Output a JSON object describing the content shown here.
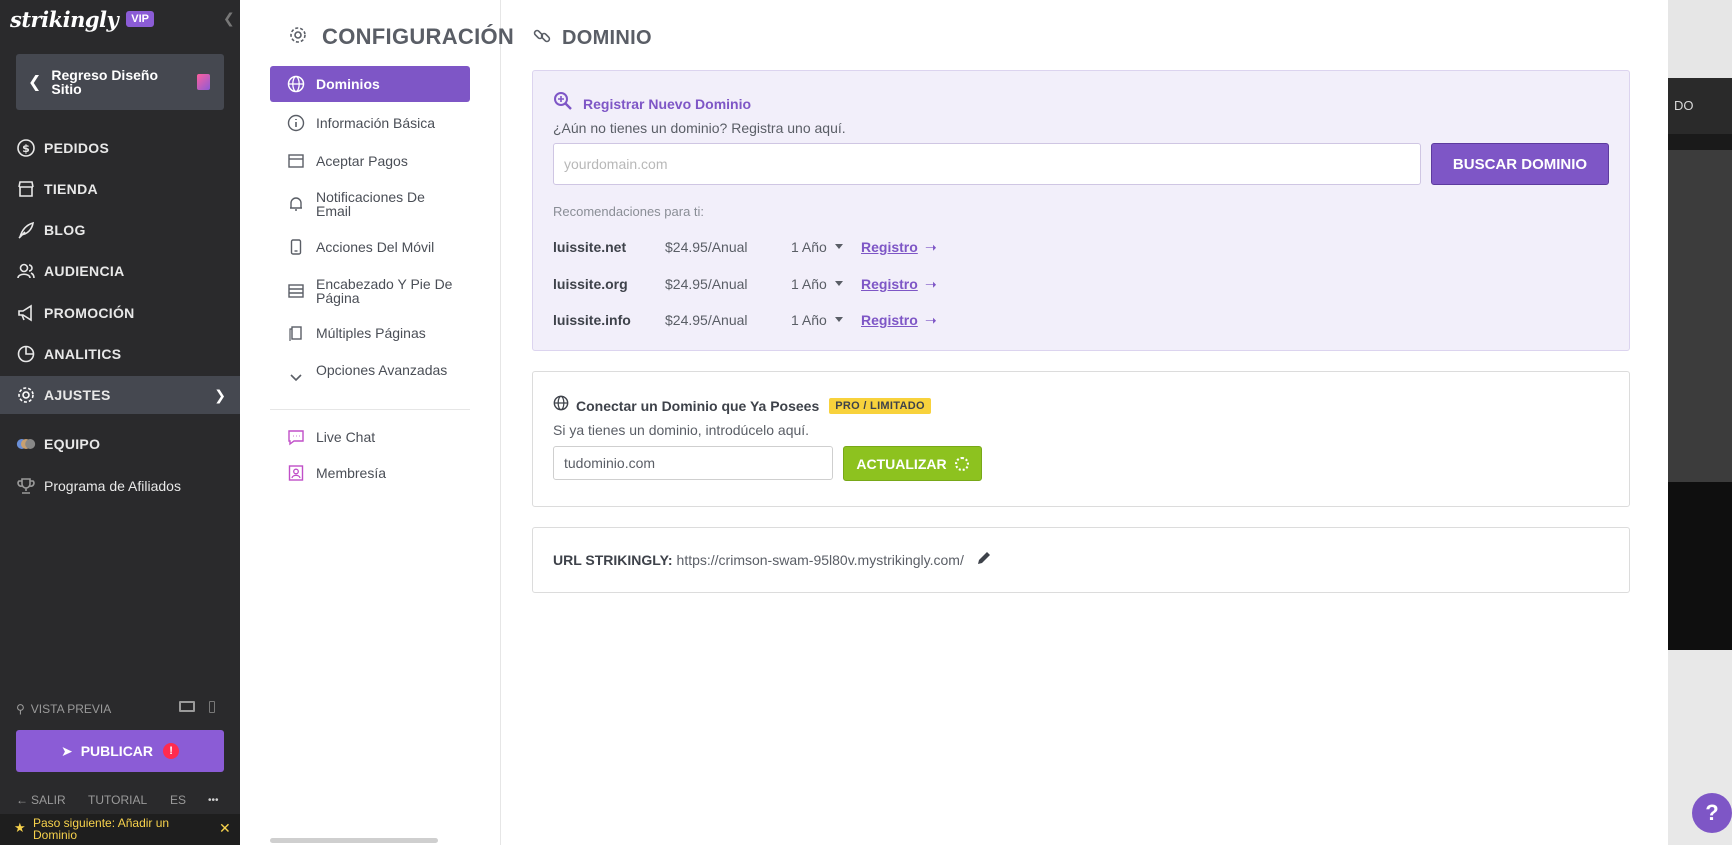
{
  "sidebar": {
    "logo": "strikingly",
    "vip_badge": "VIP",
    "back_button": "Regreso Diseño Sitio",
    "nav": [
      {
        "label": "PEDIDOS",
        "icon": "dollar-circle-icon"
      },
      {
        "label": "TIENDA",
        "icon": "store-icon"
      },
      {
        "label": "BLOG",
        "icon": "feather-icon"
      },
      {
        "label": "AUDIENCIA",
        "icon": "people-icon"
      },
      {
        "label": "PROMOCIÓN",
        "icon": "megaphone-icon"
      },
      {
        "label": "ANALITICS",
        "icon": "pie-chart-icon"
      },
      {
        "label": "AJUSTES",
        "icon": "gear-icon",
        "active": true
      },
      {
        "label": "EQUIPO",
        "icon": "team-avatars-icon"
      },
      {
        "label": "Programa de Afiliados",
        "icon": "trophy-icon"
      }
    ],
    "preview_label": "VISTA PREVIA",
    "publish_label": "PUBLICAR",
    "publish_alert": "!",
    "footer": {
      "exit": "SALIR",
      "tutorial": "TUTORIAL",
      "lang": "ES",
      "more": "•••"
    },
    "next_step": "Paso siguiente: Añadir un Dominio"
  },
  "settings": {
    "title": "CONFIGURACIÓN",
    "items": [
      {
        "label": "Dominios",
        "icon": "globe-icon",
        "active": true
      },
      {
        "label": "Información Básica",
        "icon": "info-icon"
      },
      {
        "label": "Aceptar Pagos",
        "icon": "credit-card-icon"
      },
      {
        "label": "Notificaciones De Email",
        "icon": "bell-icon"
      },
      {
        "label": "Acciones Del Móvil",
        "icon": "mobile-icon"
      },
      {
        "label": "Encabezado Y Pie De Página",
        "icon": "layout-icon"
      },
      {
        "label": "Múltiples Páginas",
        "icon": "pages-icon"
      },
      {
        "label": "Opciones Avanzadas",
        "icon": "chevron-down-icon"
      },
      {
        "label": "Live Chat",
        "icon": "chat-icon"
      },
      {
        "label": "Membresía",
        "icon": "member-icon"
      }
    ]
  },
  "content": {
    "title": "DOMINIO",
    "register": {
      "heading": "Registrar Nuevo Dominio",
      "subtitle": "¿Aún no tienes un dominio? Registra uno aquí.",
      "input_placeholder": "yourdomain.com",
      "search_button": "BUSCAR DOMINIO",
      "rec_label": "Recomendaciones para ti:",
      "recommendations": [
        {
          "domain": "luissite.net",
          "price": "$24.95/Anual",
          "term": "1 Año",
          "action": "Registro"
        },
        {
          "domain": "luissite.org",
          "price": "$24.95/Anual",
          "term": "1 Año",
          "action": "Registro"
        },
        {
          "domain": "luissite.info",
          "price": "$24.95/Anual",
          "term": "1 Año",
          "action": "Registro"
        }
      ]
    },
    "connect": {
      "heading": "Conectar un Dominio que Ya Posees",
      "badge": "PRO / LIMITADO",
      "subtitle": "Si ya tienes un dominio, introdúcelo aquí.",
      "input_value": "tudominio.com",
      "update_button": "ACTUALIZAR"
    },
    "url": {
      "label": "URL STRIKINGLY:",
      "value": "https://crimson-swam-95l80v.mystrikingly.com/"
    }
  },
  "background": {
    "peek_text": "DO"
  },
  "help_button": "?",
  "colors": {
    "accent": "#7e56c6",
    "sidebar": "#2a2a2c",
    "update": "#8dc21f",
    "badge": "#f8d23c"
  }
}
